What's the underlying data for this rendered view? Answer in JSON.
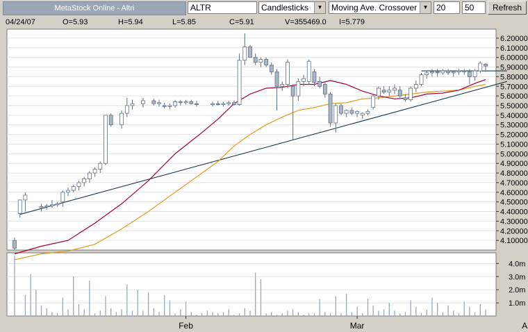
{
  "toolbar": {
    "title": "MetaStock Online - Altri",
    "symbol": "ALTR",
    "chart_style": "Candlesticks",
    "indicator": "Moving Ave. Crossover",
    "period1": "20",
    "period2": "50",
    "refresh_label": "Refresh",
    "dropdown_arrow": "▼"
  },
  "info": {
    "date": "04/24/07",
    "open": "O=5.93",
    "high": "H=5.94",
    "low": "L=5.85",
    "close": "C=5.91",
    "volume": "V=355469.0",
    "indicator": "I=5.779"
  },
  "colors": {
    "background": "#d4d0c8",
    "plot": "#ffffff",
    "grid": "#e2e2e2",
    "candle": "#a8b6c6",
    "candle_border": "#5f6f82",
    "ma_short": "#a00030",
    "ma_long": "#e09a1c",
    "trendline": "#1a3a4a",
    "volume": "#9aa8b8"
  },
  "chart_data": {
    "type": "candlestick",
    "x_ticks": [
      {
        "label": "Feb",
        "index": 32
      },
      {
        "label": "Mar",
        "index": 64
      },
      {
        "label": "Apr",
        "index": 96
      }
    ],
    "price_axis": {
      "min": 4.0,
      "max": 6.25,
      "ticks": [
        "4.10000",
        "4.20000",
        "4.30000",
        "4.40000",
        "4.50000",
        "4.60000",
        "4.70000",
        "4.80000",
        "4.90000",
        "5.00000",
        "5.10000",
        "5.20000",
        "5.30000",
        "5.40000",
        "5.50000",
        "5.60000",
        "5.70000",
        "5.80000",
        "5.90000",
        "6.00000",
        "6.10000",
        "6.20000"
      ]
    },
    "volume_axis": {
      "min": 0,
      "max": 4.6,
      "ticks": [
        {
          "label": "1.0m",
          "value": 1.0
        },
        {
          "label": "2.0m",
          "value": 2.0
        },
        {
          "label": "3.0m",
          "value": 3.0
        },
        {
          "label": "4.0m",
          "value": 4.0
        }
      ]
    },
    "candles": [
      [
        4.1,
        4.13,
        4.0,
        4.02
      ],
      [
        4.38,
        4.52,
        4.34,
        4.52
      ],
      [
        4.52,
        4.6,
        4.4,
        4.57
      ],
      [
        4.44,
        4.48,
        4.4,
        4.45
      ],
      [
        4.45,
        4.48,
        4.42,
        4.46
      ],
      [
        4.46,
        4.52,
        4.44,
        4.47
      ],
      [
        4.47,
        4.5,
        4.45,
        4.48
      ],
      [
        4.5,
        4.62,
        4.45,
        4.6
      ],
      [
        4.6,
        4.65,
        4.56,
        4.62
      ],
      [
        4.62,
        4.68,
        4.6,
        4.66
      ],
      [
        4.66,
        4.72,
        4.62,
        4.7
      ],
      [
        4.7,
        4.76,
        4.66,
        4.74
      ],
      [
        4.74,
        4.82,
        4.7,
        4.8
      ],
      [
        4.8,
        4.86,
        4.76,
        4.84
      ],
      [
        4.84,
        4.92,
        4.8,
        4.9
      ],
      [
        4.9,
        5.4,
        4.88,
        5.4
      ],
      [
        5.4,
        5.42,
        5.28,
        5.3
      ],
      [
        5.3,
        5.45,
        5.26,
        5.42
      ],
      [
        5.42,
        5.58,
        5.38,
        5.5
      ],
      [
        5.5,
        5.56,
        5.46,
        5.52
      ],
      [
        5.52,
        5.58,
        5.48,
        5.55
      ],
      [
        5.55,
        5.57,
        5.5,
        5.52
      ],
      [
        5.52,
        5.56,
        5.49,
        5.53
      ],
      [
        5.5,
        5.53,
        5.47,
        5.49
      ],
      [
        5.49,
        5.52,
        5.46,
        5.5
      ],
      [
        5.5,
        5.56,
        5.48,
        5.54
      ],
      [
        5.54,
        5.56,
        5.5,
        5.53
      ],
      [
        5.53,
        5.56,
        5.51,
        5.54
      ],
      [
        5.54,
        5.56,
        5.51,
        5.52
      ],
      [
        5.52,
        5.55,
        5.49,
        5.51
      ],
      [
        5.51,
        5.54,
        5.49,
        5.52
      ],
      [
        5.52,
        5.55,
        5.5,
        5.51
      ],
      [
        5.51,
        5.54,
        5.49,
        5.52
      ],
      [
        5.52,
        5.55,
        5.5,
        5.53
      ],
      [
        5.53,
        5.55,
        5.5,
        5.51
      ],
      [
        5.51,
        6.04,
        5.5,
        5.97
      ],
      [
        5.97,
        6.25,
        5.92,
        6.11
      ],
      [
        6.11,
        6.13,
        6.0,
        6.0
      ],
      [
        6.0,
        6.04,
        5.92,
        5.95
      ],
      [
        5.95,
        6.0,
        5.9,
        5.98
      ],
      [
        5.98,
        6.0,
        5.9,
        5.92
      ],
      [
        5.92,
        5.95,
        5.82,
        5.85
      ],
      [
        5.85,
        5.88,
        5.45,
        5.7
      ],
      [
        5.7,
        5.75,
        5.65,
        5.72
      ],
      [
        5.72,
        5.98,
        5.68,
        5.95
      ],
      [
        5.7,
        5.72,
        5.15,
        5.6
      ],
      [
        5.6,
        5.78,
        5.55,
        5.75
      ],
      [
        5.75,
        5.82,
        5.7,
        5.78
      ],
      [
        5.75,
        5.98,
        5.72,
        5.96
      ],
      [
        5.85,
        5.88,
        5.7,
        5.74
      ],
      [
        5.75,
        5.8,
        5.68,
        5.7
      ],
      [
        5.72,
        5.75,
        5.58,
        5.62
      ],
      [
        5.62,
        5.64,
        5.28,
        5.32
      ],
      [
        5.32,
        5.52,
        5.22,
        5.5
      ],
      [
        5.5,
        5.52,
        5.4,
        5.42
      ],
      [
        5.42,
        5.46,
        5.38,
        5.45
      ],
      [
        5.45,
        5.48,
        5.4,
        5.42
      ],
      [
        5.42,
        5.45,
        5.38,
        5.44
      ],
      [
        5.4,
        5.43,
        5.36,
        5.42
      ],
      [
        5.42,
        5.46,
        5.4,
        5.44
      ],
      [
        5.48,
        5.62,
        5.46,
        5.6
      ],
      [
        5.6,
        5.7,
        5.56,
        5.68
      ],
      [
        5.66,
        5.7,
        5.62,
        5.64
      ],
      [
        5.64,
        5.7,
        5.6,
        5.66
      ],
      [
        5.66,
        5.72,
        5.62,
        5.68
      ],
      [
        5.66,
        5.7,
        5.58,
        5.6
      ],
      [
        5.58,
        5.62,
        5.54,
        5.56
      ],
      [
        5.56,
        5.7,
        5.54,
        5.68
      ],
      [
        5.68,
        5.76,
        5.64,
        5.72
      ],
      [
        5.72,
        5.84,
        5.7,
        5.82
      ],
      [
        5.82,
        5.86,
        5.78,
        5.84
      ],
      [
        5.84,
        5.88,
        5.8,
        5.85
      ],
      [
        5.85,
        5.88,
        5.8,
        5.84
      ],
      [
        5.84,
        5.88,
        5.82,
        5.86
      ],
      [
        5.86,
        5.88,
        5.82,
        5.84
      ],
      [
        5.84,
        5.86,
        5.8,
        5.85
      ],
      [
        5.85,
        5.88,
        5.82,
        5.86
      ],
      [
        5.86,
        5.88,
        5.82,
        5.85
      ],
      [
        5.85,
        5.88,
        5.72,
        5.8
      ],
      [
        5.8,
        5.88,
        5.76,
        5.86
      ],
      [
        5.86,
        5.96,
        5.84,
        5.94
      ],
      [
        5.93,
        5.94,
        5.85,
        5.91
      ]
    ],
    "candle_index": [
      0,
      1,
      2,
      5,
      6,
      7,
      8,
      9,
      10,
      11,
      12,
      13,
      14,
      15,
      16,
      17,
      18,
      20,
      21,
      22,
      24,
      26,
      27,
      28,
      29,
      30,
      31,
      32,
      33,
      34,
      37,
      38,
      39,
      40,
      41,
      42,
      43,
      44,
      45,
      46,
      47,
      48,
      49,
      50,
      51,
      52,
      53,
      54,
      55,
      56,
      57,
      58,
      59,
      60,
      61,
      62,
      63,
      64,
      65,
      66,
      67,
      68,
      69,
      70,
      71,
      72,
      73,
      74,
      75,
      76,
      77,
      78,
      79,
      80,
      81,
      82,
      83,
      84,
      85,
      86,
      87,
      88
    ],
    "volume": [
      4.6,
      0.0,
      1.6,
      3.2,
      2.0,
      0.8,
      0.6,
      0.3,
      0.2,
      1.4,
      0.5,
      3.0,
      0.9,
      0.5,
      2.7,
      0.2,
      0.4,
      1.5,
      0.6,
      0.3,
      0.5,
      2.4,
      0.4,
      2.0,
      0.4,
      1.8,
      0.6,
      0.3,
      1.6,
      1.2,
      0.2,
      0.5,
      1.1,
      0.3,
      0.1,
      0.2,
      0.4,
      0.3,
      0.2,
      0.3,
      0.5,
      0.1,
      0.2,
      0.6,
      0.4,
      3.3,
      2.8,
      0.2,
      0.3,
      0.1,
      0.2,
      0.4,
      0.5,
      0.3,
      0.1,
      0.2,
      0.2,
      1.3,
      0.3,
      0.2,
      1.5,
      0.2,
      1.7,
      0.3,
      0.7,
      0.2,
      1.3,
      0.8,
      0.4,
      0.5,
      1.0,
      0.4,
      0.2,
      0.3,
      1.2,
      0.7,
      0.2,
      0.5,
      1.4,
      1.0,
      0.3,
      0.8,
      0.4,
      0.2,
      1.1,
      0.7,
      0.3,
      0.9,
      0.5
    ],
    "ma_short": [
      [
        0,
        3.96
      ],
      [
        5,
        4.04
      ],
      [
        10,
        4.1
      ],
      [
        15,
        4.28
      ],
      [
        20,
        4.48
      ],
      [
        25,
        4.72
      ],
      [
        30,
        5.0
      ],
      [
        35,
        5.22
      ],
      [
        38,
        5.36
      ],
      [
        41,
        5.52
      ],
      [
        44,
        5.62
      ],
      [
        47,
        5.68
      ],
      [
        50,
        5.69
      ],
      [
        53,
        5.72
      ],
      [
        56,
        5.72
      ],
      [
        59,
        5.76
      ],
      [
        62,
        5.72
      ],
      [
        65,
        5.65
      ],
      [
        68,
        5.6
      ],
      [
        71,
        5.57
      ],
      [
        74,
        5.58
      ],
      [
        77,
        5.62
      ],
      [
        80,
        5.63
      ],
      [
        83,
        5.66
      ],
      [
        86,
        5.73
      ],
      [
        88,
        5.77
      ]
    ],
    "ma_long": [
      [
        0,
        3.9
      ],
      [
        5,
        3.96
      ],
      [
        10,
        3.99
      ],
      [
        15,
        4.06
      ],
      [
        20,
        4.22
      ],
      [
        25,
        4.4
      ],
      [
        30,
        4.6
      ],
      [
        35,
        4.8
      ],
      [
        38,
        4.92
      ],
      [
        41,
        5.08
      ],
      [
        44,
        5.2
      ],
      [
        47,
        5.3
      ],
      [
        50,
        5.38
      ],
      [
        53,
        5.45
      ],
      [
        56,
        5.48
      ],
      [
        59,
        5.52
      ],
      [
        62,
        5.53
      ],
      [
        65,
        5.57
      ],
      [
        68,
        5.58
      ],
      [
        71,
        5.6
      ],
      [
        74,
        5.62
      ],
      [
        77,
        5.64
      ],
      [
        80,
        5.65
      ],
      [
        83,
        5.66
      ],
      [
        86,
        5.7
      ],
      [
        88,
        5.72
      ]
    ],
    "trendlines": [
      {
        "from": [
          1,
          4.37
        ],
        "to": [
          92,
          5.75
        ]
      },
      {
        "from": [
          76,
          5.86
        ],
        "to": [
          92,
          5.86
        ]
      }
    ]
  }
}
